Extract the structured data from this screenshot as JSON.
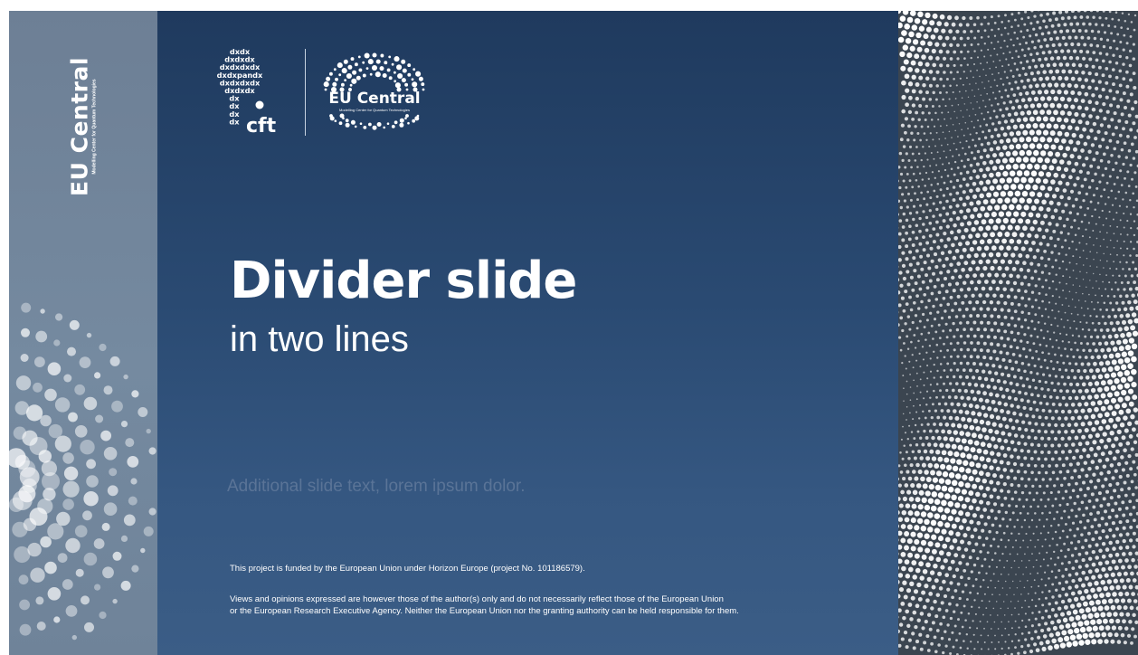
{
  "colors": {
    "main_background_top": "#1f3a5e",
    "main_background_bottom": "#3b5d86",
    "side_strip": "#758aa0",
    "text": "#ffffff",
    "muted_text": "#5a7497"
  },
  "sidebar": {
    "brand_title": "EU Central",
    "brand_subtitle": "Modelling Center for Quantum Technologies"
  },
  "logos": {
    "dx_logo_lines": [
      "dxdx",
      "dxdxdx",
      "dxdxdxdx",
      "dxdxpandx",
      "dxdxdxdx",
      "dxdxdx",
      "dx",
      "dx",
      "dx",
      "dx"
    ],
    "cft_text": "cft",
    "eu_central_title": "EU Central",
    "eu_central_subtitle": "Modelling Center for Quantum Technologies"
  },
  "slide": {
    "title": "Divider slide",
    "subtitle": "in two lines",
    "additional_text": "Additional slide text, lorem ipsum dolor.",
    "funding_text": "This project is funded by the European Union under Horizon Europe (project No. 101186579).",
    "disclaimer_line1": "Views and opinions expressed are however those of the author(s) only and do not necessarily reflect those of the European Union",
    "disclaimer_line2": "or the European Research Executive Agency. Neither the European Union nor the granting authority can be held responsible for them."
  },
  "icons": {
    "decorative_dots": "dot-pattern-icon",
    "wave_pattern": "wave-dot-pattern-icon"
  }
}
